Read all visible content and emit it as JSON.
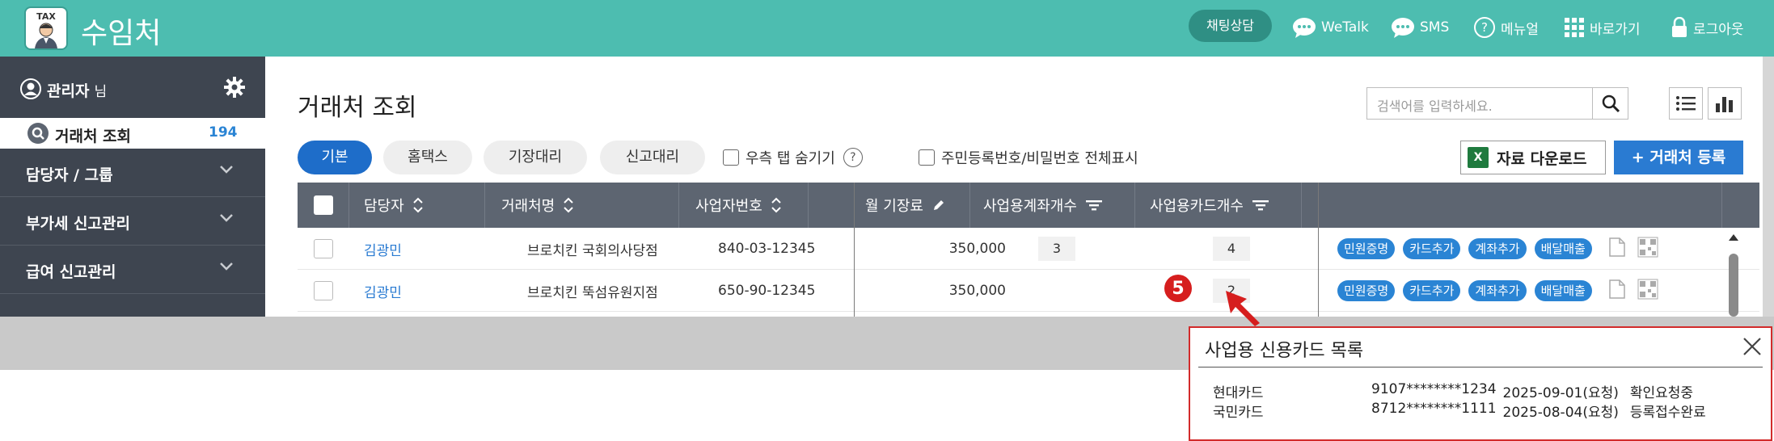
{
  "app": {
    "logo_text": "TAX",
    "title": "수임처"
  },
  "topnav": {
    "chat": "채팅상담",
    "wetalk": "WeTalk",
    "sms": "SMS",
    "manual": "메뉴얼",
    "shortcut": "바로가기",
    "logout": "로그아웃"
  },
  "sidebar": {
    "user": "관리자",
    "user_suffix": "님",
    "active_item": {
      "label": "거래처 조회",
      "count": "194"
    },
    "items": [
      {
        "label": "담당자 / 그룹"
      },
      {
        "label": "부가세 신고관리"
      },
      {
        "label": "급여 신고관리"
      }
    ]
  },
  "page": {
    "title": "거래처 조회",
    "search_placeholder": "검색어를 입력하세요.",
    "tabs": [
      "기본",
      "홈택스",
      "기장대리",
      "신고대리"
    ],
    "hide_right_tab": "우측 탭 숨기기",
    "show_all": "주민등록번호/비밀번호 전체표시",
    "download": "자료 다운로드",
    "register": "+ 거래처 등록"
  },
  "table": {
    "headers": {
      "manager": "담당자",
      "client": "거래처명",
      "bizno": "사업자번호",
      "fee": "월 기장료",
      "accounts": "사업용계좌개수",
      "cards": "사업용카드개수"
    },
    "rows": [
      {
        "manager": "김광민",
        "client": "브로치킨 국회의사당점",
        "bizno": "840-03-12345",
        "fee": "350,000",
        "accounts": "3",
        "cards": "4"
      },
      {
        "manager": "김광민",
        "client": "브로치킨 뚝섬유원지점",
        "bizno": "650-90-12345",
        "fee": "350,000",
        "accounts": "",
        "cards": "2"
      }
    ],
    "actions": [
      "민원증명",
      "카드추가",
      "계좌추가",
      "배달매출"
    ]
  },
  "callout": {
    "number": "5"
  },
  "popup": {
    "title": "사업용 신용카드 목록",
    "rows": [
      {
        "company": "현대카드",
        "number": "9107********1234",
        "date": "2025-09-01(요청)",
        "status": "확인요청중"
      },
      {
        "company": "국민카드",
        "number": "8712********1111",
        "date": "2025-08-04(요청)",
        "status": "등록접수완료"
      }
    ]
  },
  "colors": {
    "topbar": "#4dbdb0",
    "sidebar": "#3e4550",
    "accent": "#2a7bd2",
    "alert": "#d61e1e"
  }
}
